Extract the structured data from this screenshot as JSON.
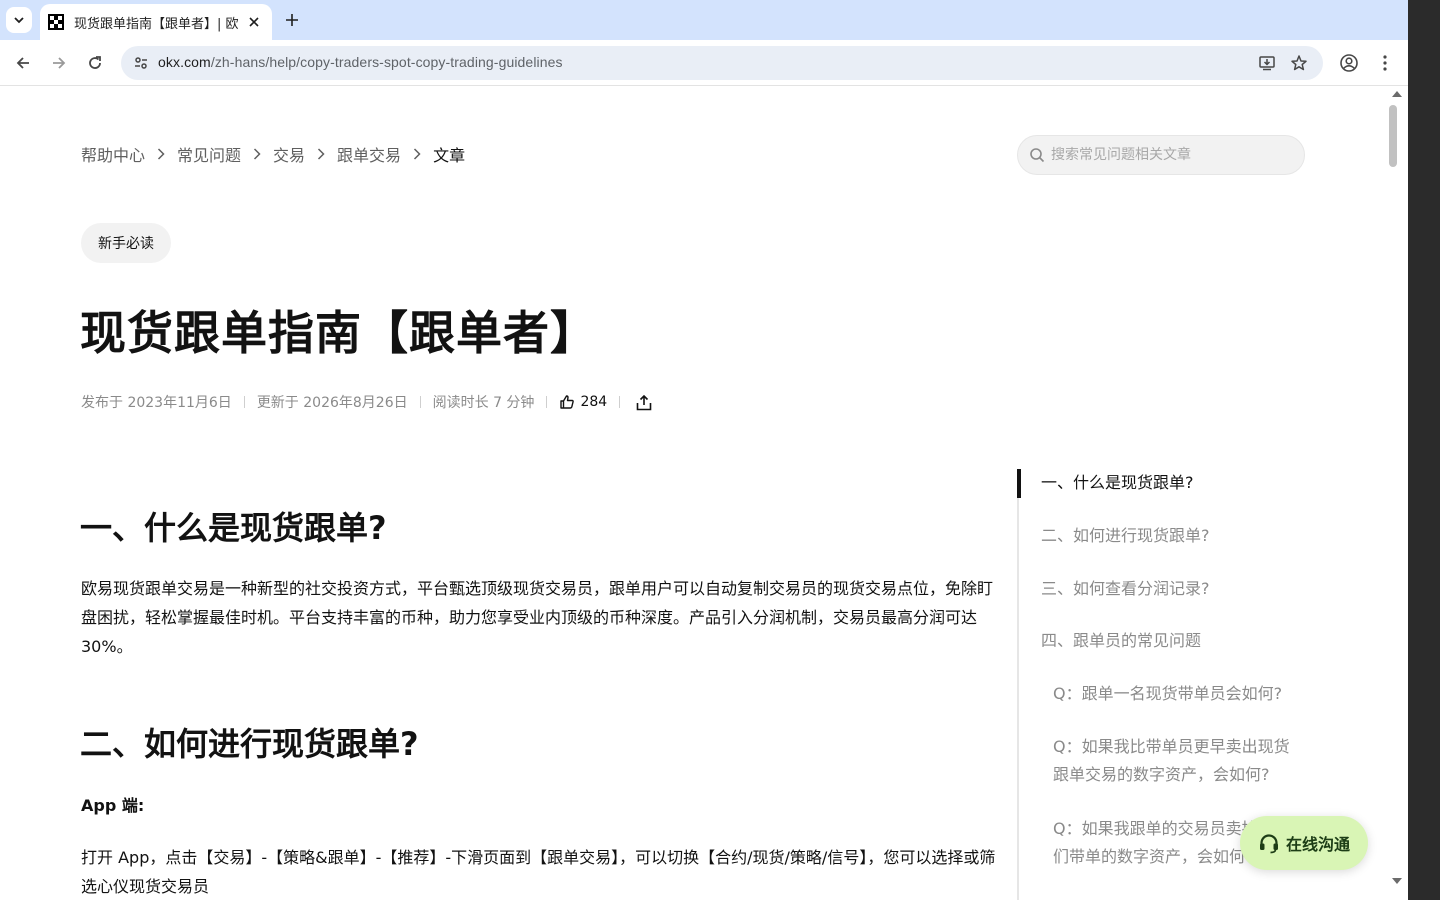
{
  "browser": {
    "tab_title": "现货跟单指南【跟单者】| 欧",
    "url_host": "okx.com",
    "url_path": "/zh-hans/help/copy-traders-spot-copy-trading-guidelines"
  },
  "breadcrumb": [
    "帮助中心",
    "常见问题",
    "交易",
    "跟单交易",
    "文章"
  ],
  "search": {
    "placeholder": "搜索常见问题相关文章"
  },
  "tag": "新手必读",
  "article": {
    "title": "现货跟单指南【跟单者】",
    "published": "发布于 2023年11月6日",
    "updated": "更新于 2026年8月26日",
    "read_time": "阅读时长 7 分钟",
    "likes": "284",
    "section1_title": "一、什么是现货跟单?",
    "section1_body": "欧易现货跟单交易是一种新型的社交投资方式，平台甄选顶级现货交易员，跟单用户可以自动复制交易员的现货交易点位，免除盯盘困扰，轻松掌握最佳时机。平台支持丰富的币种，助力您享受业内顶级的币种深度。产品引入分润机制，交易员最高分润可达30%。",
    "section2_title": "二、如何进行现货跟单?",
    "app_label": "App 端:",
    "section2_body": "打开 App，点击【交易】-【策略&跟单】-【推荐】-下滑页面到【跟单交易】，可以切换【合约/现货/策略/信号】，您可以选择或筛选心仪现货交易员"
  },
  "toc": {
    "items": [
      "一、什么是现货跟单?",
      "二、如何进行现货跟单?",
      "三、如何查看分润记录?",
      "四、跟单员的常见问题"
    ],
    "sub_items": [
      "Q：跟单一名现货带单员会如何?",
      "Q：如果我比带单员更早卖出现货跟单交易的数字资产，会如何?",
      "Q：如果我跟单的交易员卖掉了他们带单的数字资产，会如何?"
    ],
    "active_index": 0
  },
  "chat_button": "在线沟通",
  "colors": {
    "accent_chat_bg": "#d9f5b5",
    "text_primary": "#121212",
    "text_secondary": "#8a8a8a"
  }
}
